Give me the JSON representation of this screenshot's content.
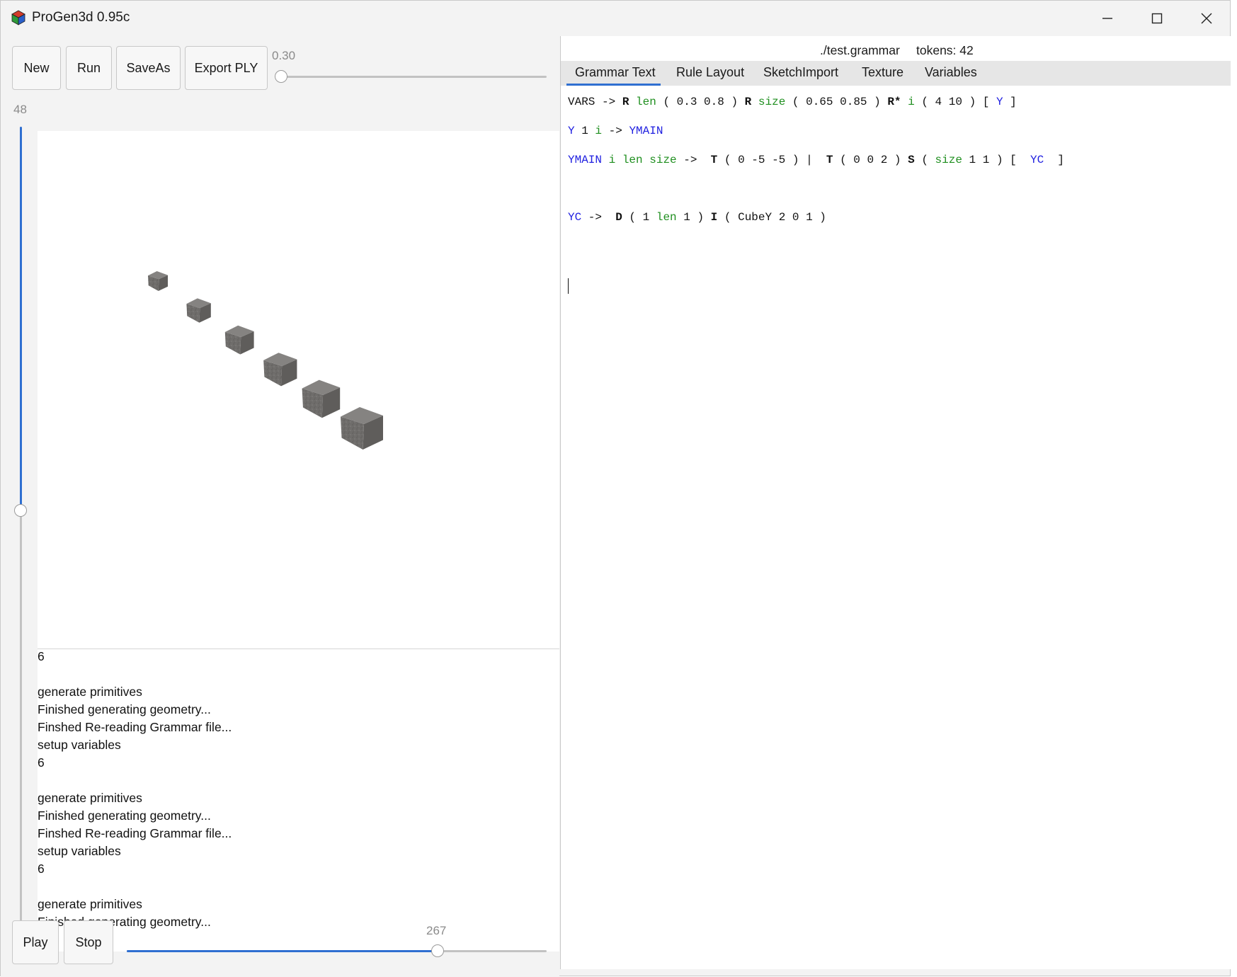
{
  "window": {
    "title": "ProGen3d 0.95c"
  },
  "toolbar": {
    "new_label": "New",
    "run_label": "Run",
    "saveas_label": "SaveAs",
    "export_label": "Export PLY",
    "slider_value": "0.30",
    "slider_fraction": 0.0
  },
  "vertical_slider": {
    "value_label": "48",
    "fill_fraction": 0.55
  },
  "console": {
    "lines": [
      "6",
      "",
      "generate primitives",
      "Finished generating geometry...",
      "Finshed Re-reading Grammar file...",
      "setup variables",
      "6",
      "",
      "generate primitives",
      "Finished generating geometry...",
      "Finshed Re-reading Grammar file...",
      "setup variables",
      "6",
      "",
      "generate primitives",
      "Finished generating geometry..."
    ]
  },
  "playback": {
    "play_label": "Play",
    "stop_label": "Stop",
    "frame_value": "267",
    "frame_fraction": 0.74
  },
  "file_info": {
    "path": "./test.grammar",
    "tokens": "tokens: 42"
  },
  "tabs": [
    "Grammar Text",
    "Rule Layout",
    "SketchImport",
    "Texture",
    "Variables"
  ],
  "active_tab": "Grammar Text",
  "colors": {
    "accent": "#2f6fd1",
    "keyword_blue": "#1f1fe0",
    "variable_green": "#1f8f1f"
  },
  "grammar_lines": [
    [
      {
        "t": "VARS -> ",
        "c": "kw"
      },
      {
        "t": "R",
        "c": "bold"
      },
      {
        "t": " ",
        "c": "kw"
      },
      {
        "t": "len",
        "c": "green"
      },
      {
        "t": " ( 0.3 0.8 ) ",
        "c": "kw"
      },
      {
        "t": "R",
        "c": "bold"
      },
      {
        "t": " ",
        "c": "kw"
      },
      {
        "t": "size",
        "c": "green"
      },
      {
        "t": " ( 0.65 0.85 ) ",
        "c": "kw"
      },
      {
        "t": "R*",
        "c": "bold"
      },
      {
        "t": " ",
        "c": "kw"
      },
      {
        "t": "i",
        "c": "green"
      },
      {
        "t": " ( 4 10 ) [ ",
        "c": "kw"
      },
      {
        "t": "Y",
        "c": "blue"
      },
      {
        "t": " ]",
        "c": "kw"
      }
    ],
    [
      {
        "t": "Y",
        "c": "blue"
      },
      {
        "t": " 1 ",
        "c": "kw"
      },
      {
        "t": "i",
        "c": "green"
      },
      {
        "t": " -> ",
        "c": "kw"
      },
      {
        "t": "YMAIN",
        "c": "blue"
      }
    ],
    [
      {
        "t": "YMAIN",
        "c": "blue"
      },
      {
        "t": " ",
        "c": "kw"
      },
      {
        "t": "i len size",
        "c": "green"
      },
      {
        "t": " ->  ",
        "c": "kw"
      },
      {
        "t": "T",
        "c": "bold"
      },
      {
        "t": " ( 0 -5 -5 ) |  ",
        "c": "kw"
      },
      {
        "t": "T",
        "c": "bold"
      },
      {
        "t": " ( 0 0 2 ) ",
        "c": "kw"
      },
      {
        "t": "S",
        "c": "bold"
      },
      {
        "t": " ( ",
        "c": "kw"
      },
      {
        "t": "size",
        "c": "green"
      },
      {
        "t": " 1 1 ) [  ",
        "c": "kw"
      },
      {
        "t": "YC",
        "c": "blue"
      },
      {
        "t": "  ]",
        "c": "kw"
      }
    ],
    [],
    [
      {
        "t": "YC",
        "c": "blue"
      },
      {
        "t": " ->  ",
        "c": "kw"
      },
      {
        "t": "D",
        "c": "bold"
      },
      {
        "t": " ( 1 ",
        "c": "kw"
      },
      {
        "t": "len",
        "c": "green"
      },
      {
        "t": " 1 ) ",
        "c": "kw"
      },
      {
        "t": "I",
        "c": "bold"
      },
      {
        "t": " ( CubeY 2 0 1 )",
        "c": "kw"
      }
    ]
  ],
  "scene": {
    "cube_count": 6
  }
}
